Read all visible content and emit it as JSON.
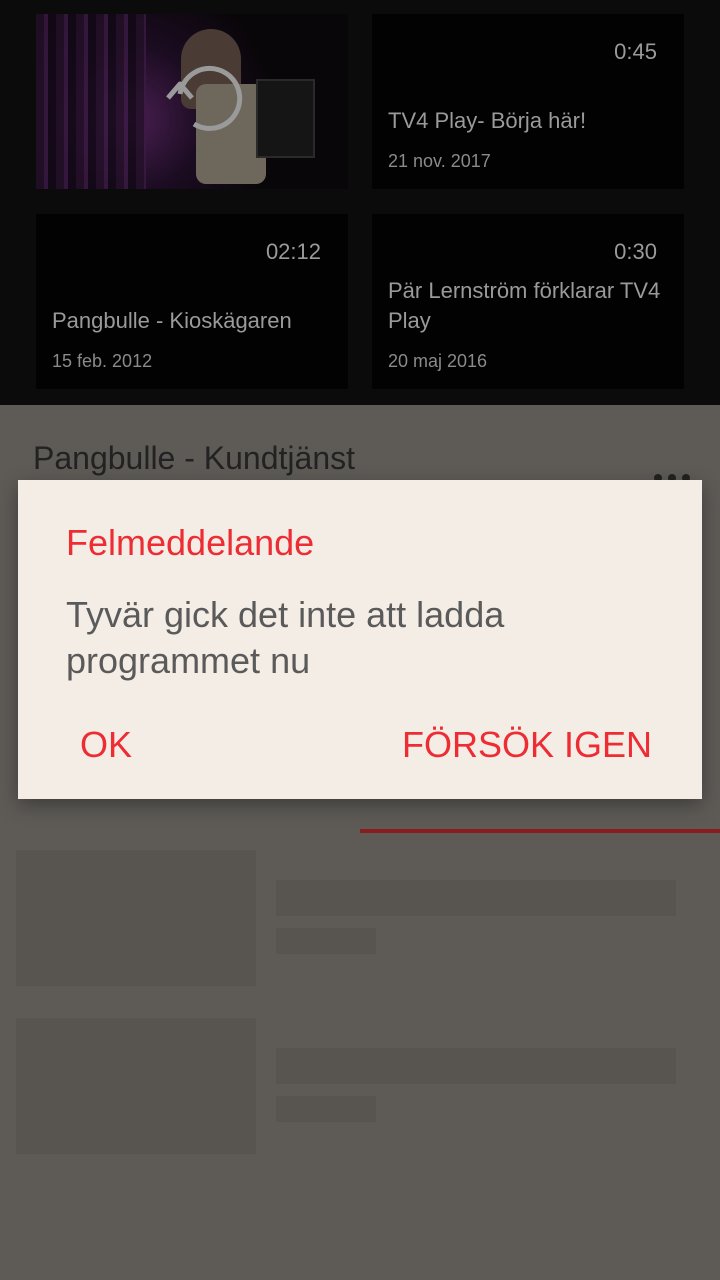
{
  "videos": [
    {
      "title": "",
      "date": "",
      "duration": ""
    },
    {
      "title": "TV4 Play- Börja här!",
      "date": "21 nov. 2017",
      "duration": "0:45"
    },
    {
      "title": "Pangbulle - Kioskägaren",
      "date": "15 feb. 2012",
      "duration": "02:12"
    },
    {
      "title": "Pär Lernström förklarar TV4 Play",
      "date": "20 maj 2016",
      "duration": "0:30"
    }
  ],
  "sheet": {
    "title": "Pangbulle - Kundtjänst",
    "more_icon": "more-horizontal-icon"
  },
  "dialog": {
    "title": "Felmeddelande",
    "message": "Tyvär gick det inte att ladda programmet nu",
    "ok_label": "OK",
    "retry_label": "FÖRSÖK IGEN"
  },
  "colors": {
    "accent": "#ed2c34",
    "dialog_bg": "#f4ede5",
    "scrim": "#5e5b57",
    "tab_indicator": "#8a1b1e"
  },
  "icons": {
    "replay": "replay-icon"
  }
}
